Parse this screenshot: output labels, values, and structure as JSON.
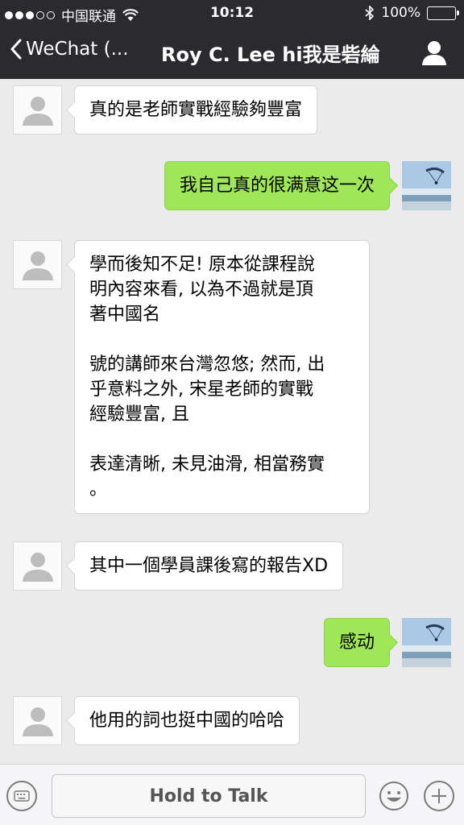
{
  "status": {
    "carrier": "中国联通",
    "time": "10:12",
    "battery": "100%",
    "signal_bars_filled": 3,
    "signal_bars_total": 5
  },
  "nav": {
    "back_label": "WeChat (...",
    "title": "Roy C. Lee hi我是砦綸"
  },
  "messages": [
    {
      "side": "left",
      "text": "真的是老師實戰經驗夠豐富"
    },
    {
      "side": "right",
      "text": "我自己真的很满意这一次"
    },
    {
      "side": "left",
      "text": "學而後知不足! 原本從課程說\n明內容來看, 以為不過就是頂\n著中國名\n\n號的講師來台灣忽悠; 然而, 出\n乎意料之外, 宋星老師的實戰\n經驗豐富, 且\n\n表達清晰, 未見油滑, 相當務實\n。"
    },
    {
      "side": "left",
      "text": "其中一個學員課後寫的報告XD"
    },
    {
      "side": "right",
      "text": "感动"
    },
    {
      "side": "left",
      "text": "他用的詞也挺中國的哈哈"
    }
  ],
  "toolbar": {
    "hold_to_talk": "Hold to Talk"
  },
  "colors": {
    "header_bg": "#2b2b2f",
    "chat_bg": "#ebebeb",
    "bubble_right": "#9fe658",
    "bubble_left": "#ffffff"
  }
}
